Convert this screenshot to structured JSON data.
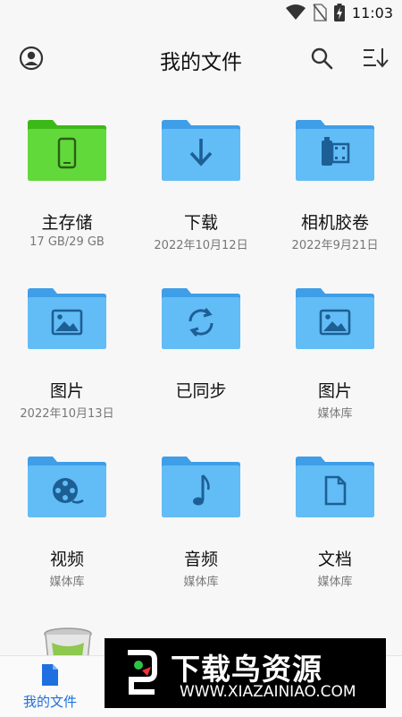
{
  "status_bar": {
    "time": "11:03",
    "icons": [
      "wifi-icon",
      "no-sim-icon",
      "battery-charging-icon"
    ]
  },
  "header": {
    "title": "我的文件",
    "profile_icon": "account-circle-icon",
    "search_icon": "search-icon",
    "sort_icon": "sort-icon"
  },
  "folders": [
    {
      "name": "主存储",
      "subtitle": "17 GB/29 GB",
      "icon": "phone-icon",
      "color": "#5fd13a"
    },
    {
      "name": "下载",
      "subtitle": "2022年10月12日",
      "icon": "download-icon",
      "color": "#5bb8f5"
    },
    {
      "name": "相机胶卷",
      "subtitle": "2022年9月21日",
      "icon": "film-icon",
      "color": "#5bb8f5"
    },
    {
      "name": "图片",
      "subtitle": "2022年10月13日",
      "icon": "image-icon",
      "color": "#5bb8f5"
    },
    {
      "name": "已同步",
      "subtitle": "",
      "icon": "sync-icon",
      "color": "#5bb8f5"
    },
    {
      "name": "图片",
      "subtitle": "媒体库",
      "icon": "image-icon",
      "color": "#5bb8f5"
    },
    {
      "name": "视频",
      "subtitle": "媒体库",
      "icon": "film-reel-icon",
      "color": "#5bb8f5"
    },
    {
      "name": "音频",
      "subtitle": "媒体库",
      "icon": "music-note-icon",
      "color": "#5bb8f5"
    },
    {
      "name": "文档",
      "subtitle": "媒体库",
      "icon": "document-icon",
      "color": "#5bb8f5"
    }
  ],
  "bottom_nav": {
    "active_label": "我的文件",
    "active_icon": "file-icon",
    "accent": "#1e6fe0"
  },
  "watermark": {
    "title": "下载鸟资源",
    "url": "WWW.XIAZAINIAO.COM"
  }
}
